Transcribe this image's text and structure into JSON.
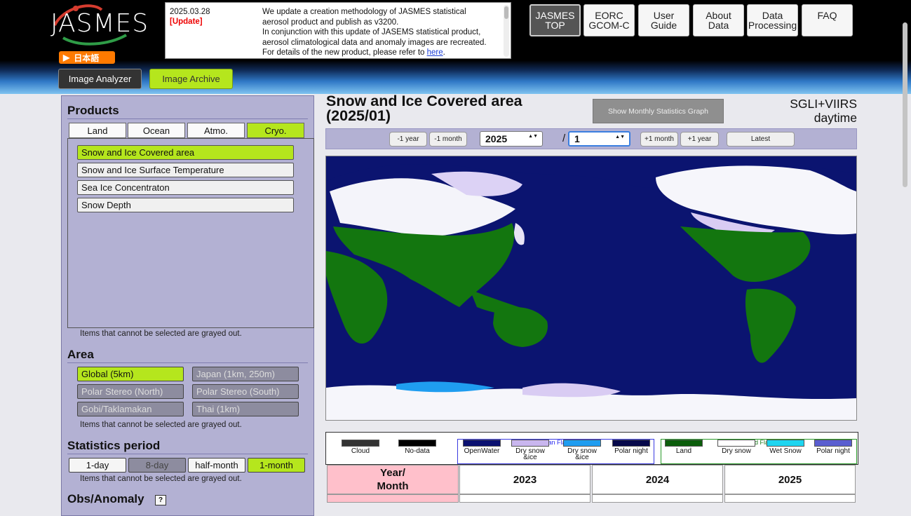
{
  "header": {
    "logo_text": "JASMES",
    "lang_button": "日本語",
    "news": {
      "date": "2025.03.28",
      "tag": "[Update]",
      "lines": [
        "We update a creation methodology of JASMES statistical",
        "aerosol product and publish as v3200.",
        "In conjunction with this update of JASEMS statistical product,",
        "aerosol climatological data and anomaly images are recreated."
      ],
      "last_line_prefix": "For details of the new product, please refer to ",
      "link_text": "here",
      "last_line_suffix": "."
    },
    "nav": [
      {
        "line1": "JASMES",
        "line2": "TOP",
        "active": true
      },
      {
        "line1": "EORC",
        "line2": "GCOM-C",
        "active": false
      },
      {
        "line1": "User",
        "line2": "Guide",
        "active": false
      },
      {
        "line1": "About",
        "line2": "Data",
        "active": false
      },
      {
        "line1": "Data",
        "line2": "Processing",
        "active": false
      },
      {
        "line1": "FAQ",
        "line2": "",
        "active": false
      }
    ],
    "tabs": {
      "analyzer": "Image Analyzer",
      "archive": "Image Archive"
    }
  },
  "panel": {
    "products_title": "Products",
    "product_tabs": [
      "Land",
      "Ocean",
      "Atmo.",
      "Cryo."
    ],
    "active_tab": "Cryo.",
    "product_items": [
      "Snow and Ice Covered area",
      "Snow and Ice Surface Temperature",
      "Sea Ice Concentraton",
      "Snow Depth"
    ],
    "grayed_note": "Items that cannot be selected are grayed out.",
    "area_title": "Area",
    "areas": [
      "Global (5km)",
      "Japan (1km, 250m)",
      "Polar Stereo (North)",
      "Polar Stereo (South)",
      "Gobi/Taklamakan",
      "Thai (1km)"
    ],
    "stats_title": "Statistics period",
    "periods": [
      "1-day",
      "8-day",
      "half-month",
      "1-month"
    ],
    "obs_title": "Obs/Anomaly",
    "help_label": "?"
  },
  "main": {
    "title_line1": "Snow and Ice Covered area",
    "title_line2": "(2025/01)",
    "graph_button": "Show Monthly Statistics Graph",
    "sensor_line1": "SGLI+VIIRS",
    "sensor_line2": "daytime",
    "toolbar": {
      "prev_year": "-1 year",
      "prev_month": "-1 month",
      "year": "2025",
      "separator": "/",
      "month": "1",
      "next_month": "+1 month",
      "next_year": "+1 year",
      "latest": "Latest",
      "select_arrows": "▲▼"
    }
  },
  "legend": {
    "ocean_title": "Ocean Flags",
    "land_title": "Land Flags",
    "items": [
      {
        "label": "Cloud",
        "color": "#333333"
      },
      {
        "label": "No-data",
        "color": "#000000"
      },
      {
        "label": "OpenWater",
        "color": "#0a1070"
      },
      {
        "label": "Dry snow &ice",
        "color": "#c9b6ee"
      },
      {
        "label": "Dry snow &ice",
        "color": "#1f9df0"
      },
      {
        "label": "Polar night",
        "color": "#06084a"
      },
      {
        "label": "Land",
        "color": "#0b5d0b"
      },
      {
        "label": "Dry snow",
        "color": "#ffffff"
      },
      {
        "label": "Wet Snow",
        "color": "#1ed5f0"
      },
      {
        "label": "Polar night",
        "color": "#5a5ed0"
      }
    ]
  },
  "table": {
    "header_label": "Year/\nMonth",
    "years": [
      "2023",
      "2024",
      "2025"
    ]
  },
  "colors": {
    "accent_green": "#b5e61d",
    "panel_purple": "#b3b1d3",
    "update_red": "#ee0000",
    "lang_orange": "#ff7a00"
  }
}
